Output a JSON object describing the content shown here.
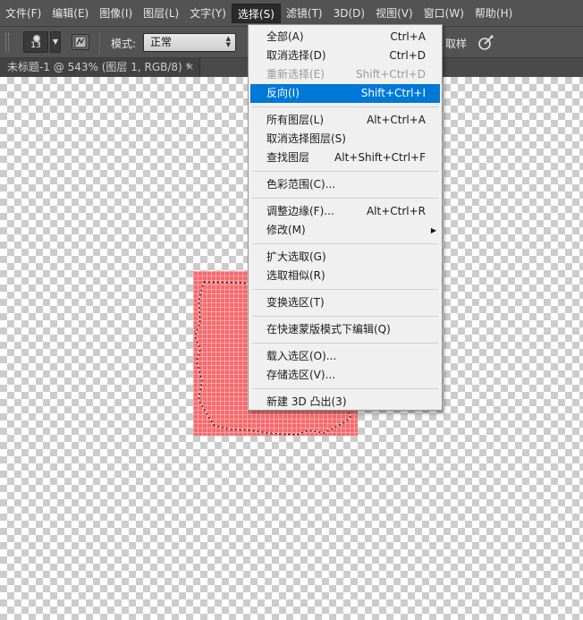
{
  "menubar": {
    "items": [
      {
        "label": "文件(F)"
      },
      {
        "label": "编辑(E)"
      },
      {
        "label": "图像(I)"
      },
      {
        "label": "图层(L)"
      },
      {
        "label": "文字(Y)"
      },
      {
        "label": "选择(S)",
        "active": true
      },
      {
        "label": "滤镜(T)"
      },
      {
        "label": "3D(D)"
      },
      {
        "label": "视图(V)"
      },
      {
        "label": "窗口(W)"
      },
      {
        "label": "帮助(H)"
      }
    ]
  },
  "options": {
    "brush_size": "13",
    "mode_label": "模式:",
    "mode_value": "正常",
    "sample_label": "取样",
    "brush_icon": "brush-panel-icon",
    "airbrush_icon": "airbrush-icon"
  },
  "document": {
    "tab_title": "未标题-1 @ 543% (图层 1, RGB/8) *",
    "close_glyph": "×"
  },
  "colors": {
    "layer_fill": "#f46a6d",
    "highlight": "#0078d7",
    "menu_bg": "#f0f0f0",
    "chrome_bg": "#535353"
  },
  "select_menu": {
    "items": [
      {
        "label": "全部(A)",
        "shortcut": "Ctrl+A"
      },
      {
        "label": "取消选择(D)",
        "shortcut": "Ctrl+D"
      },
      {
        "label": "重新选择(E)",
        "shortcut": "Shift+Ctrl+D",
        "disabled": true
      },
      {
        "label": "反向(I)",
        "shortcut": "Shift+Ctrl+I",
        "highlighted": true
      },
      {
        "separator": true
      },
      {
        "label": "所有图层(L)",
        "shortcut": "Alt+Ctrl+A"
      },
      {
        "label": "取消选择图层(S)",
        "shortcut": ""
      },
      {
        "label": "查找图层",
        "shortcut": "Alt+Shift+Ctrl+F"
      },
      {
        "separator": true
      },
      {
        "label": "色彩范围(C)...",
        "shortcut": ""
      },
      {
        "separator": true
      },
      {
        "label": "调整边缘(F)...",
        "shortcut": "Alt+Ctrl+R"
      },
      {
        "label": "修改(M)",
        "shortcut": "",
        "submenu": true
      },
      {
        "separator": true
      },
      {
        "label": "扩大选取(G)",
        "shortcut": ""
      },
      {
        "label": "选取相似(R)",
        "shortcut": ""
      },
      {
        "separator": true
      },
      {
        "label": "变换选区(T)",
        "shortcut": ""
      },
      {
        "separator": true
      },
      {
        "label": "在快速蒙版模式下编辑(Q)",
        "shortcut": ""
      },
      {
        "separator": true
      },
      {
        "label": "载入选区(O)...",
        "shortcut": ""
      },
      {
        "label": "存储选区(V)...",
        "shortcut": ""
      },
      {
        "separator": true
      },
      {
        "label": "新建 3D 凸出(3)",
        "shortcut": ""
      }
    ]
  }
}
